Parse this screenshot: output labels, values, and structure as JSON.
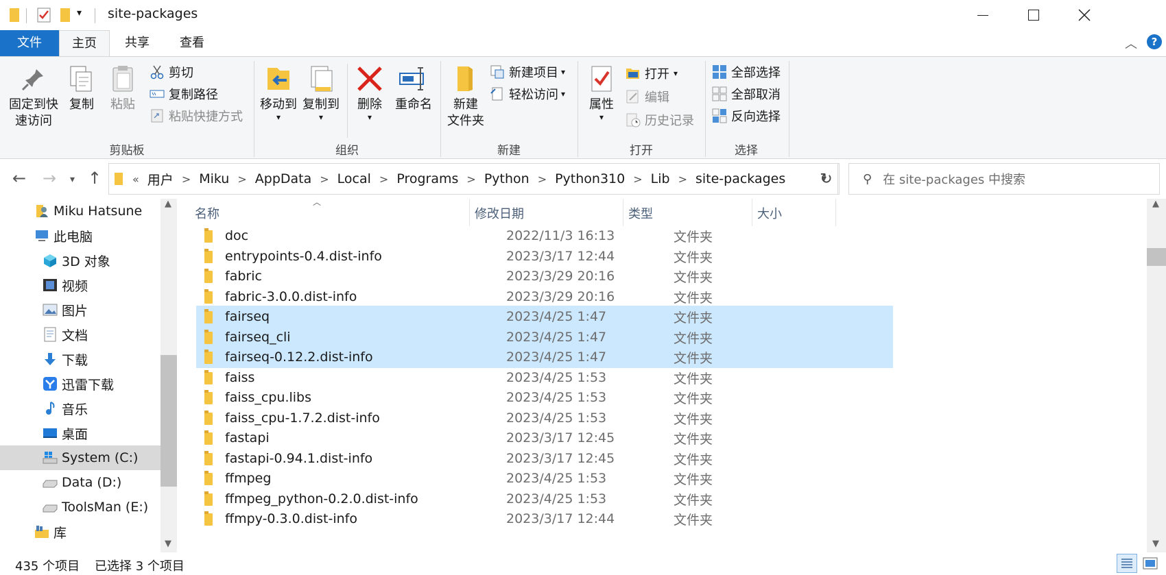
{
  "window": {
    "title": "site-packages"
  },
  "tabs": {
    "file": "文件",
    "home": "主页",
    "share": "共享",
    "view": "查看"
  },
  "ribbon": {
    "clipboard": {
      "label": "剪贴板",
      "pin_line1": "固定到快",
      "pin_line2": "速访问",
      "copy": "复制",
      "paste": "粘贴",
      "cut": "剪切",
      "copy_path": "复制路径",
      "paste_shortcut": "粘贴快捷方式"
    },
    "organize": {
      "label": "组织",
      "move_to": "移动到",
      "copy_to": "复制到",
      "delete": "删除",
      "rename": "重命名"
    },
    "new": {
      "label": "新建",
      "new_folder_line1": "新建",
      "new_folder_line2": "文件夹",
      "new_item": "新建项目",
      "easy_access": "轻松访问"
    },
    "open": {
      "label": "打开",
      "properties": "属性",
      "open": "打开",
      "edit": "编辑",
      "history": "历史记录"
    },
    "select": {
      "label": "选择",
      "select_all": "全部选择",
      "select_none": "全部取消",
      "invert": "反向选择"
    }
  },
  "address": {
    "overflow": "«",
    "crumbs": [
      "用户",
      "Miku",
      "AppData",
      "Local",
      "Programs",
      "Python",
      "Python310",
      "Lib",
      "site-packages"
    ]
  },
  "search": {
    "placeholder": "在 site-packages 中搜索"
  },
  "sidebar": {
    "items": [
      {
        "label": "Miku Hatsune",
        "icon": "user-icon"
      },
      {
        "label": "此电脑",
        "icon": "computer-icon"
      },
      {
        "label": "3D 对象",
        "icon": "cube-icon"
      },
      {
        "label": "视频",
        "icon": "video-icon"
      },
      {
        "label": "图片",
        "icon": "picture-icon"
      },
      {
        "label": "文档",
        "icon": "document-icon"
      },
      {
        "label": "下载",
        "icon": "download-icon"
      },
      {
        "label": "迅雷下载",
        "icon": "thunder-icon"
      },
      {
        "label": "音乐",
        "icon": "music-icon"
      },
      {
        "label": "桌面",
        "icon": "desktop-icon"
      },
      {
        "label": "System (C:)",
        "icon": "system-drive-icon"
      },
      {
        "label": "Data (D:)",
        "icon": "drive-icon"
      },
      {
        "label": "ToolsMan (E:)",
        "icon": "drive-icon"
      },
      {
        "label": "库",
        "icon": "library-icon"
      }
    ]
  },
  "columns": {
    "name": "名称",
    "date": "修改日期",
    "type": "类型",
    "size": "大小"
  },
  "files": [
    {
      "name": "doc",
      "date": "2022/11/3 16:13",
      "type": "文件夹",
      "selected": false
    },
    {
      "name": "entrypoints-0.4.dist-info",
      "date": "2023/3/17 12:44",
      "type": "文件夹",
      "selected": false
    },
    {
      "name": "fabric",
      "date": "2023/3/29 20:16",
      "type": "文件夹",
      "selected": false
    },
    {
      "name": "fabric-3.0.0.dist-info",
      "date": "2023/3/29 20:16",
      "type": "文件夹",
      "selected": false
    },
    {
      "name": "fairseq",
      "date": "2023/4/25 1:47",
      "type": "文件夹",
      "selected": true
    },
    {
      "name": "fairseq_cli",
      "date": "2023/4/25 1:47",
      "type": "文件夹",
      "selected": true
    },
    {
      "name": "fairseq-0.12.2.dist-info",
      "date": "2023/4/25 1:47",
      "type": "文件夹",
      "selected": true
    },
    {
      "name": "faiss",
      "date": "2023/4/25 1:53",
      "type": "文件夹",
      "selected": false
    },
    {
      "name": "faiss_cpu.libs",
      "date": "2023/4/25 1:53",
      "type": "文件夹",
      "selected": false
    },
    {
      "name": "faiss_cpu-1.7.2.dist-info",
      "date": "2023/4/25 1:53",
      "type": "文件夹",
      "selected": false
    },
    {
      "name": "fastapi",
      "date": "2023/3/17 12:45",
      "type": "文件夹",
      "selected": false
    },
    {
      "name": "fastapi-0.94.1.dist-info",
      "date": "2023/3/17 12:45",
      "type": "文件夹",
      "selected": false
    },
    {
      "name": "ffmpeg",
      "date": "2023/4/25 1:53",
      "type": "文件夹",
      "selected": false
    },
    {
      "name": "ffmpeg_python-0.2.0.dist-info",
      "date": "2023/4/25 1:53",
      "type": "文件夹",
      "selected": false
    },
    {
      "name": "ffmpy-0.3.0.dist-info",
      "date": "2023/3/17 12:44",
      "type": "文件夹",
      "selected": false
    }
  ],
  "status": {
    "count": "435 个项目",
    "selected": "已选择 3 个项目"
  },
  "colors": {
    "accent": "#1a73c8",
    "selection": "#cce8ff",
    "folder": "#f5c542"
  }
}
